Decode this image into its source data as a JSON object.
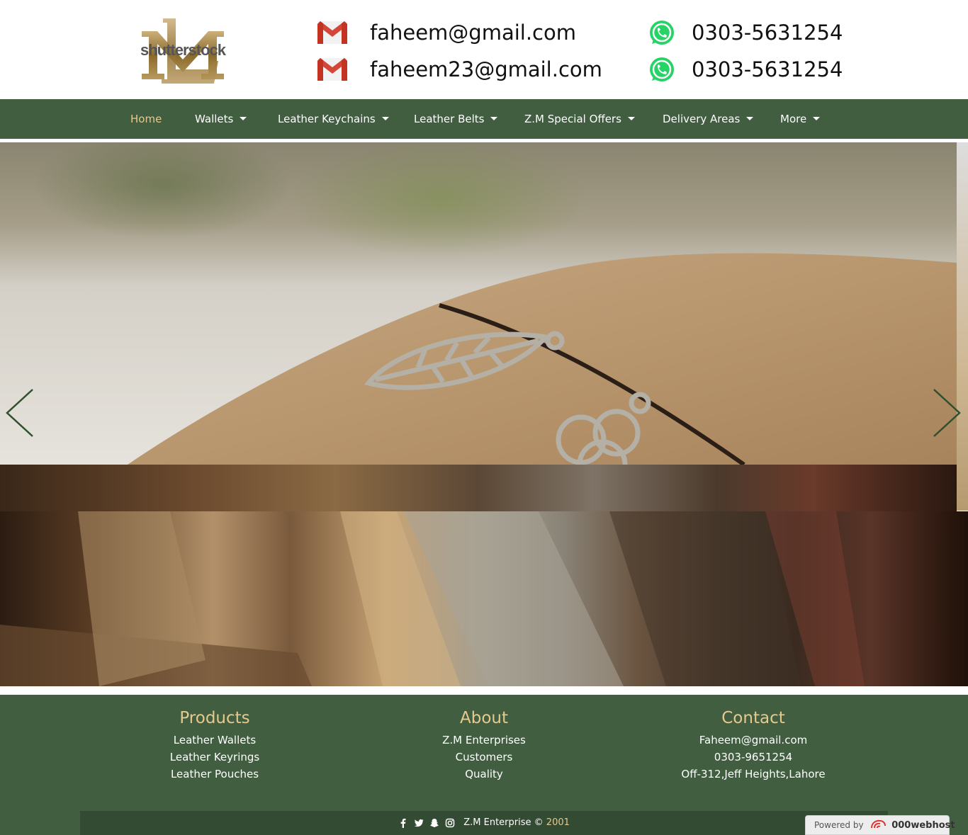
{
  "header": {
    "logo_text": "shutterstock",
    "emails": [
      "faheem@gmail.com",
      "faheem23@gmail.com"
    ],
    "phones": [
      "0303-5631254",
      "0303-5631254"
    ],
    "icons": {
      "email": "gmail-icon",
      "phone": "whatsapp-icon"
    }
  },
  "nav": {
    "items": [
      {
        "label": "Home",
        "active": true,
        "dropdown": false
      },
      {
        "label": "Wallets",
        "active": false,
        "dropdown": true
      },
      {
        "label": "Leather Keychains",
        "active": false,
        "dropdown": true
      },
      {
        "label": "Leather Belts",
        "active": false,
        "dropdown": true
      },
      {
        "label": "Z.M Special Offers",
        "active": false,
        "dropdown": true
      },
      {
        "label": "Delivery Areas",
        "active": false,
        "dropdown": true
      },
      {
        "label": "More",
        "active": false,
        "dropdown": true
      }
    ]
  },
  "slider": {
    "prev_icon": "chevron-left-icon",
    "next_icon": "chevron-right-icon"
  },
  "footer": {
    "products": {
      "title": "Products",
      "lines": [
        "Leather Wallets",
        "Leather Keyrings",
        "Leather Pouches"
      ]
    },
    "about": {
      "title": "About",
      "lines": [
        "Z.M Enterprises",
        "Customers",
        "Quality"
      ]
    },
    "contact": {
      "title": "Contact",
      "lines": [
        "Faheem@gmail.com",
        "0303-9651254",
        "Off-312,Jeff Heights,Lahore"
      ]
    },
    "copyright": "Z.M Enterprise ©",
    "year": "2001",
    "social_icons": [
      "facebook-icon",
      "twitter-icon",
      "snapchat-icon",
      "instagram-icon"
    ]
  },
  "badge": {
    "prefix": "Powered by",
    "brand": "000webhost"
  },
  "colors": {
    "nav_bg": "#415e41",
    "accent": "#e6c98c",
    "bottom_bar": "#334a33"
  }
}
